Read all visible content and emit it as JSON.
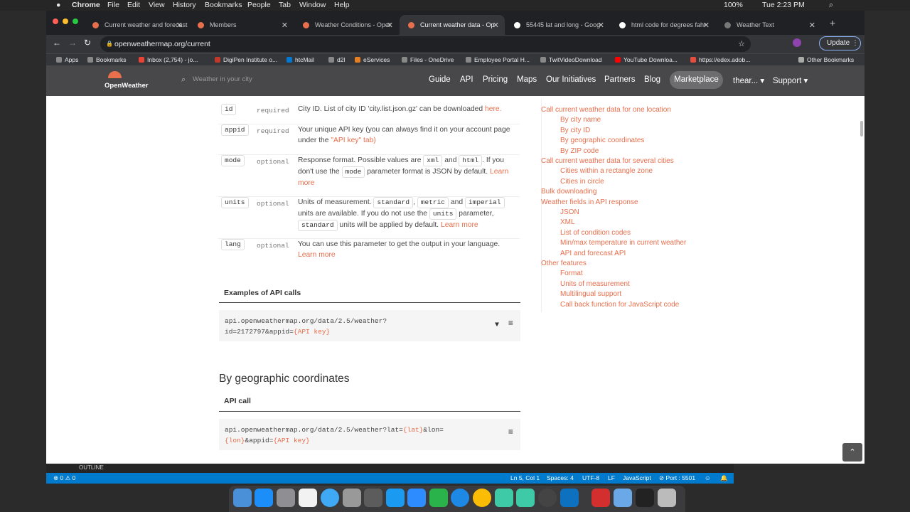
{
  "menubar": {
    "app": "Chrome",
    "items": [
      "File",
      "Edit",
      "View",
      "History",
      "Bookmarks",
      "People",
      "Tab",
      "Window",
      "Help"
    ],
    "battery": "100%",
    "clock": "Tue 2:23 PM"
  },
  "tabs": [
    {
      "label": "Current weather and forecast",
      "active": false
    },
    {
      "label": "Members",
      "active": false
    },
    {
      "label": "Weather Conditions - Oper",
      "active": false
    },
    {
      "label": "Current weather data - Op",
      "active": true
    },
    {
      "label": "55445 lat and long - Goog",
      "active": false
    },
    {
      "label": "html code for degrees fahr",
      "active": false
    },
    {
      "label": "Weather Text",
      "active": false
    }
  ],
  "url": "openweathermap.org/current",
  "update_label": "Update",
  "bookmarks": [
    "Apps",
    "Bookmarks",
    "Inbox (2,754) - jo...",
    "DigiPen Institute o...",
    "htcMail",
    "d2l",
    "eServices",
    "Files - OneDrive",
    "Employee Portal H...",
    "TwitVideoDownload",
    "YouTube Downloa...",
    "https://edex.adob...",
    "Other Bookmarks"
  ],
  "site": {
    "logo": "OpenWeather",
    "search_placeholder": "Weather in your city",
    "nav": [
      "Guide",
      "API",
      "Pricing",
      "Maps",
      "Our Initiatives",
      "Partners",
      "Blog",
      "Marketplace",
      "thear...",
      "Support"
    ]
  },
  "params": [
    {
      "name": "id",
      "req": "required",
      "desc": "City ID. List of city ID 'city.list.json.gz' can be downloaded ",
      "link": "here."
    },
    {
      "name": "appid",
      "req": "required",
      "desc": "Your unique API key (you can always find it on your account page under the ",
      "link": "\"API key\" tab)"
    },
    {
      "name": "mode",
      "req": "optional",
      "d1": "Response format. Possible values are ",
      "c1": "xml",
      "d2": " and ",
      "c2": "html",
      "d3": ". If you don't use the ",
      "c3": "mode",
      "d4": " parameter format is JSON by default. ",
      "link": "Learn more"
    },
    {
      "name": "units",
      "req": "optional",
      "d1": "Units of measurement. ",
      "c1": "standard",
      "d2": ", ",
      "c2": "metric",
      "d3": " and ",
      "c3": "imperial",
      "d4": " units are available. If you do not use the ",
      "c4": "units",
      "d5": " parameter, ",
      "c5": "standard",
      "d6": " units will be applied by default. ",
      "link": "Learn more"
    },
    {
      "name": "lang",
      "req": "optional",
      "desc": "You can use this parameter to get the output in your language. ",
      "link": "Learn more"
    }
  ],
  "examples_heading": "Examples of API calls",
  "example1": {
    "line1": "api.openweathermap.org/data/2.5/weather?",
    "line2a": "id=2172797&appid=",
    "line2b": "{API key}"
  },
  "geo_heading": "By geographic coordinates",
  "api_call_label": "API call",
  "example2": {
    "a": "api.openweathermap.org/data/2.5/weather?lat=",
    "b": "{lat}",
    "c": "&lon=",
    "d": "{lon}",
    "e": "&appid=",
    "f": "{API key}"
  },
  "toc": [
    {
      "t": "Call current weather data for one location",
      "lvl": 0
    },
    {
      "t": "By city name",
      "lvl": 1
    },
    {
      "t": "By city ID",
      "lvl": 1
    },
    {
      "t": "By geographic coordinates",
      "lvl": 1
    },
    {
      "t": "By ZIP code",
      "lvl": 1
    },
    {
      "t": "Call current weather data for several cities",
      "lvl": 0
    },
    {
      "t": "Cities within a rectangle zone",
      "lvl": 1
    },
    {
      "t": "Cities in circle",
      "lvl": 1
    },
    {
      "t": "Bulk downloading",
      "lvl": 0
    },
    {
      "t": "Weather fields in API response",
      "lvl": 0
    },
    {
      "t": "JSON",
      "lvl": 1
    },
    {
      "t": "XML",
      "lvl": 1
    },
    {
      "t": "List of condition codes",
      "lvl": 1
    },
    {
      "t": "Min/max temperature in current weather",
      "lvl": 1
    },
    {
      "t": "API and forecast API",
      "lvl": 1
    },
    {
      "t": "Other features",
      "lvl": 0
    },
    {
      "t": "Format",
      "lvl": 1
    },
    {
      "t": "Units of measurement",
      "lvl": 1
    },
    {
      "t": "Multilingual support",
      "lvl": 1
    },
    {
      "t": "Call back function for JavaScript code",
      "lvl": 1
    }
  ],
  "vscode": {
    "outline": "OUTLINE",
    "problems": "⊗ 0 ⚠ 0",
    "pos": "Ln 5, Col 1",
    "spaces": "Spaces: 4",
    "enc": "UTF-8",
    "eol": "LF",
    "lang": "JavaScript",
    "port": "⊘ Port : 5501"
  }
}
